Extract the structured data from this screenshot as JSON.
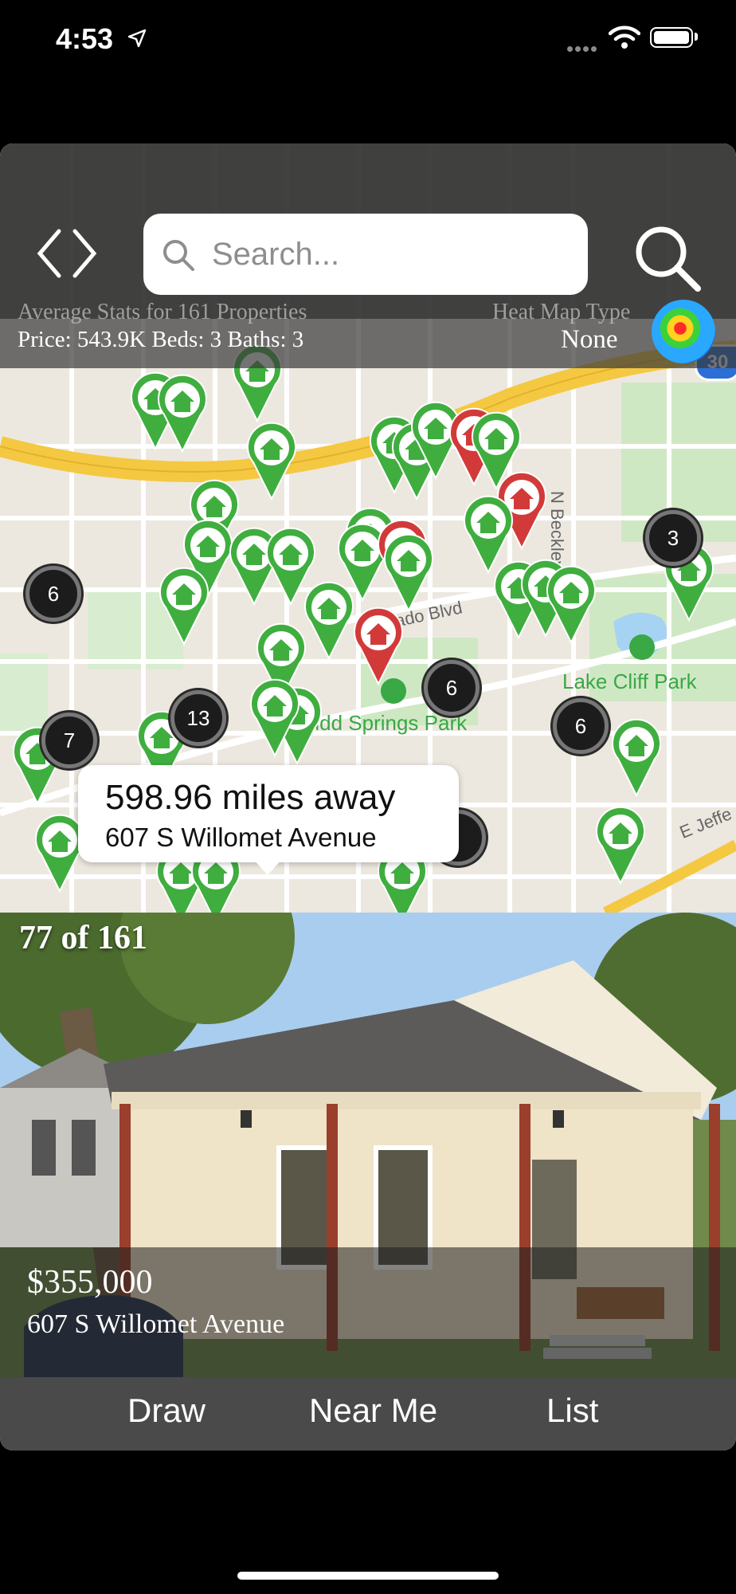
{
  "status_bar": {
    "time": "4:53"
  },
  "search": {
    "placeholder": "Search..."
  },
  "stats": {
    "title": "Average Stats for 161 Properties",
    "summary": "Price: 543.9K Beds: 3 Baths: 3",
    "heatmap_label": "Heat Map Type",
    "heatmap_value": "None"
  },
  "map": {
    "labels": {
      "lake_cliff_park": "Lake Cliff Park",
      "kidd_springs_park": "Kidd Springs Park",
      "n_beckley_ave": "N Beckley Ave",
      "colorado_blvd": "orado Blvd",
      "e_jefferson": "E Jeffe",
      "highway_shield": "30"
    },
    "clusters": [
      "6",
      "3",
      "6",
      "6",
      "13",
      "7"
    ]
  },
  "callout": {
    "distance": "598.96 miles away",
    "address": "607 S Willomet Avenue"
  },
  "listing": {
    "counter": "77 of 161",
    "price": "$355,000",
    "address": "607 S Willomet Avenue"
  },
  "toolbar": {
    "draw": "Draw",
    "near_me": "Near Me",
    "list": "List"
  },
  "colors": {
    "pin_green": "#3fae3f",
    "pin_red": "#d23a3a",
    "park_green": "#39a845",
    "highway_yellow": "#f5c842"
  }
}
